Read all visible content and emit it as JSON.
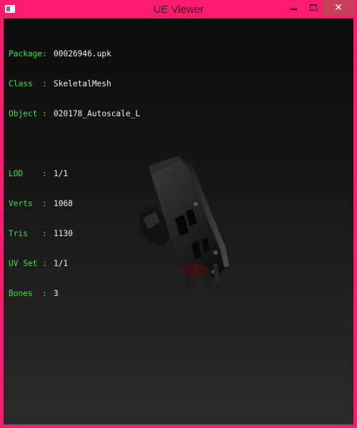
{
  "window": {
    "title": "UE Viewer",
    "close_glyph": "✕"
  },
  "info": {
    "package": {
      "key": "Package:",
      "value": "00026946.upk"
    },
    "class": {
      "key": "Class  :",
      "value": "SkeletalMesh"
    },
    "object": {
      "key": "Object :",
      "value": "020178_Autoscale_L"
    },
    "lod": {
      "key": "LOD    :",
      "value": "1/1"
    },
    "verts": {
      "key": "Verts  :",
      "value": "1068"
    },
    "tris": {
      "key": "Tris   :",
      "value": "1130"
    },
    "uvset": {
      "key": "UV Set :",
      "value": "1/1"
    },
    "bones": {
      "key": "Bones  :",
      "value": "3"
    }
  },
  "colors": {
    "frame": "#ff1c6e",
    "label_green": "#3ee03e",
    "value_white": "#f0f0f0"
  },
  "icons": {
    "app": "app-icon",
    "minimize": "minimize-icon",
    "maximize": "maximize-icon",
    "close": "close-icon"
  }
}
